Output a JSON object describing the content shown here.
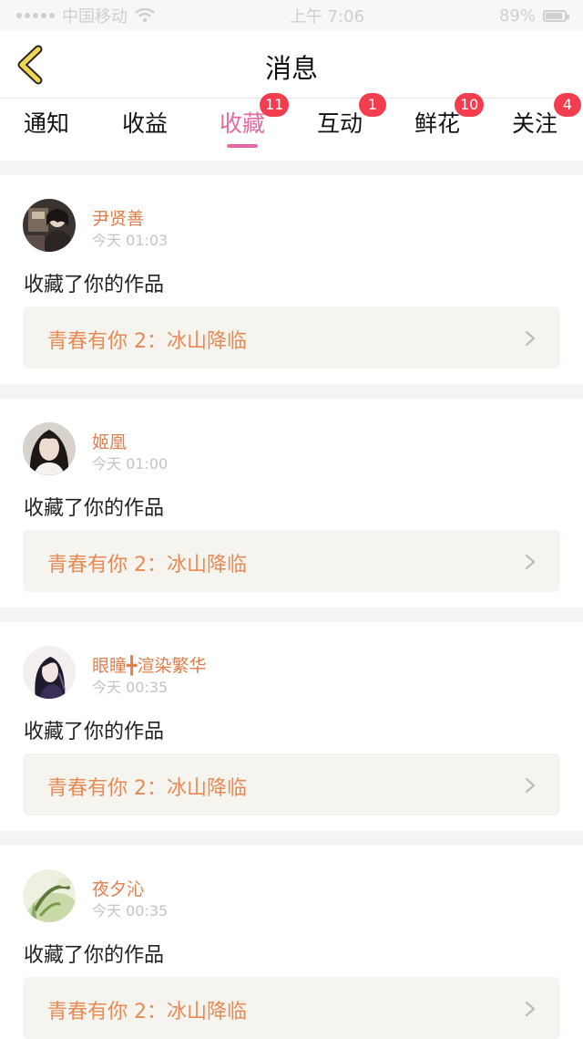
{
  "status_bar": {
    "carrier": "中国移动",
    "time": "上午 7:06",
    "battery": "89%"
  },
  "header": {
    "title": "消息",
    "back_icon": "chevron-left-icon"
  },
  "tabs": [
    {
      "label": "通知",
      "badge": ""
    },
    {
      "label": "收益",
      "badge": ""
    },
    {
      "label": "收藏",
      "badge": "11",
      "active": true
    },
    {
      "label": "互动",
      "badge": "1"
    },
    {
      "label": "鲜花",
      "badge": "10"
    },
    {
      "label": "关注",
      "badge": "4"
    }
  ],
  "messages": [
    {
      "username": "尹贤善",
      "time": "今天 01:03",
      "action": "收藏了你的作品",
      "work_title": "青春有你 2：冰山降临"
    },
    {
      "username": "姬凰",
      "time": "今天 01:00",
      "action": "收藏了你的作品",
      "work_title": "青春有你 2：冰山降临"
    },
    {
      "username": "眼瞳╋渲染繁华",
      "time": "今天 00:35",
      "action": "收藏了你的作品",
      "work_title": "青春有你 2：冰山降临"
    },
    {
      "username": "夜夕沁",
      "time": "今天 00:35",
      "action": "收藏了你的作品",
      "work_title": "青春有你 2：冰山降临"
    }
  ],
  "colors": {
    "accent": "#e56aa1",
    "badge": "#f23d4f",
    "username": "#e07e4c",
    "work_title": "#e88a55",
    "work_box_bg": "#f6f4ee"
  }
}
